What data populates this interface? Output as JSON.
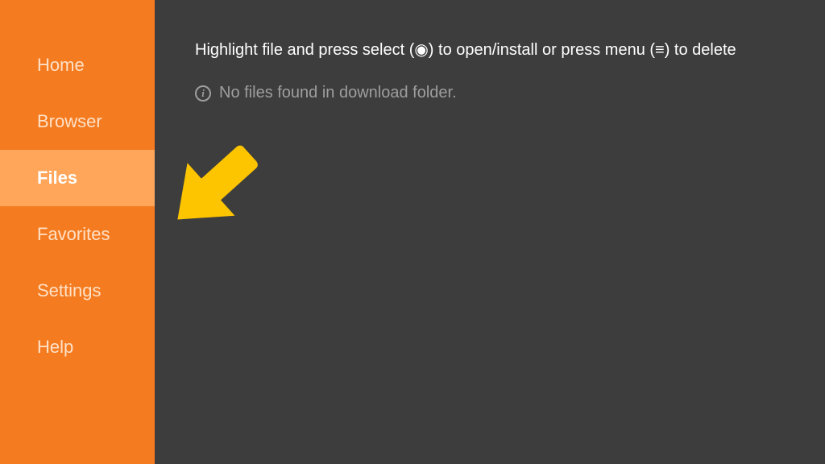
{
  "sidebar": {
    "items": [
      {
        "label": "Home",
        "selected": false
      },
      {
        "label": "Browser",
        "selected": false
      },
      {
        "label": "Files",
        "selected": true
      },
      {
        "label": "Favorites",
        "selected": false
      },
      {
        "label": "Settings",
        "selected": false
      },
      {
        "label": "Help",
        "selected": false
      }
    ]
  },
  "content": {
    "instruction": "Highlight file and press select (◉) to open/install or press menu (≡) to delete",
    "info_message": "No files found in download folder."
  },
  "colors": {
    "sidebar_bg": "#f47b20",
    "sidebar_selected_bg": "#ffa65a",
    "content_bg": "#3d3d3d",
    "annotation_arrow": "#fdc400"
  }
}
